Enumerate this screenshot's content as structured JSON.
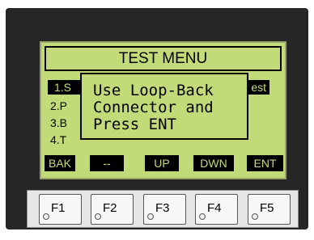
{
  "screen": {
    "title": "TEST MENU",
    "menu_items": [
      {
        "label": "1.S",
        "tail": "est"
      },
      {
        "label": "2.P"
      },
      {
        "label": "3.B"
      },
      {
        "label": "4.T"
      }
    ],
    "popup": {
      "lines": [
        "Use Loop-Back",
        "Connector and",
        "Press ENT"
      ]
    },
    "softkeys": [
      "BAK",
      "--",
      "UP",
      "DWN",
      "ENT"
    ]
  },
  "function_keys": [
    "F1",
    "F2",
    "F3",
    "F4",
    "F5"
  ],
  "colors": {
    "lcd_background": "#c2db78",
    "bezel": "#262626",
    "key_panel": "#e6e6e6"
  }
}
